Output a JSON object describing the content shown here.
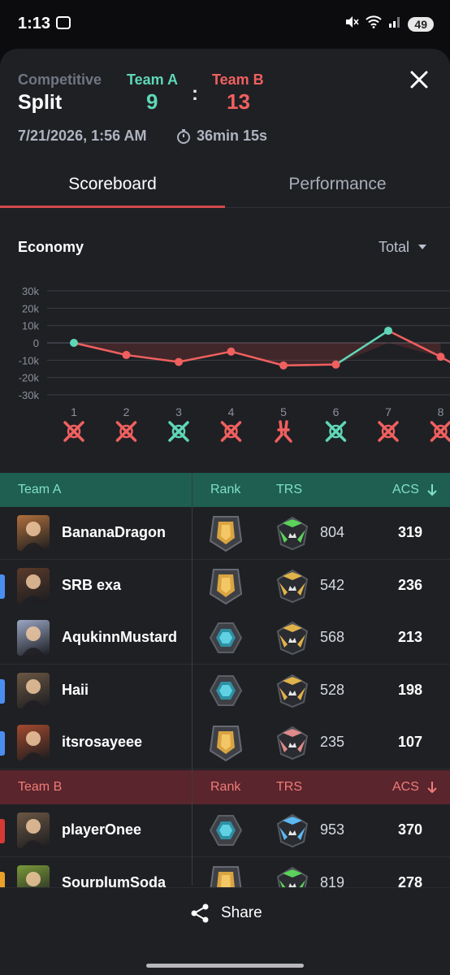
{
  "status_bar": {
    "time": "1:13",
    "battery": "49"
  },
  "header": {
    "mode": "Competitive",
    "map": "Split",
    "team_a": {
      "name": "Team A",
      "score": "9",
      "color": "#5fd7b7"
    },
    "team_b": {
      "name": "Team B",
      "score": "13",
      "color": "#f0605f"
    },
    "separator": ":",
    "date": "7/21/2026, 1:56 AM",
    "duration": "36min 15s"
  },
  "tabs": [
    {
      "label": "Scoreboard",
      "active": true
    },
    {
      "label": "Performance",
      "active": false
    }
  ],
  "economy": {
    "title": "Economy",
    "selector": "Total",
    "chart_data": {
      "type": "line",
      "y_ticks": [
        "30k",
        "20k",
        "10k",
        "0",
        "-10k",
        "-20k",
        "-30k"
      ],
      "ylim": [
        -30000,
        30000
      ],
      "x": [
        1,
        2,
        3,
        4,
        5,
        6,
        7,
        8
      ],
      "values": [
        0,
        -7000,
        -11000,
        -5000,
        -13000,
        -12500,
        7000,
        -8000
      ],
      "round_results": [
        {
          "round": "1",
          "winner": "B",
          "icon": "elimination-icon"
        },
        {
          "round": "2",
          "winner": "B",
          "icon": "elimination-icon"
        },
        {
          "round": "3",
          "winner": "A",
          "icon": "elimination-icon"
        },
        {
          "round": "4",
          "winner": "B",
          "icon": "elimination-icon"
        },
        {
          "round": "5",
          "winner": "B",
          "icon": "defuse-icon"
        },
        {
          "round": "6",
          "winner": "A",
          "icon": "elimination-icon"
        },
        {
          "round": "7",
          "winner": "B",
          "icon": "elimination-icon"
        },
        {
          "round": "8",
          "winner": "B",
          "icon": "elimination-icon"
        }
      ]
    }
  },
  "scoreboard": {
    "columns": {
      "rank": "Rank",
      "trs": "TRS",
      "acs": "ACS"
    },
    "teams": [
      {
        "name": "Team A",
        "header_color": "#1f5f51",
        "label_color": "#7fe0c6",
        "players": [
          {
            "name": "BananaDragon",
            "rank": "gold",
            "trs_tier": "green",
            "trs": "804",
            "acs": "319",
            "marker": null,
            "avatar": "#b0703c"
          },
          {
            "name": "SRB exa",
            "rank": "gold",
            "trs_tier": "gold",
            "trs": "542",
            "acs": "236",
            "marker": "#4a8ff0",
            "avatar": "#5b3b2a"
          },
          {
            "name": "AqukinnMustard",
            "rank": "platinum",
            "trs_tier": "gold",
            "trs": "568",
            "acs": "213",
            "marker": null,
            "avatar": "#9aa6c4"
          },
          {
            "name": "Haii",
            "rank": "platinum",
            "trs_tier": "gold",
            "trs": "528",
            "acs": "198",
            "marker": "#4a8ff0",
            "avatar": "#6b5744"
          },
          {
            "name": "itsrosayeee",
            "rank": "gold",
            "trs_tier": "red",
            "trs": "235",
            "acs": "107",
            "marker": "#4a8ff0",
            "avatar": "#a34a2e"
          }
        ]
      },
      {
        "name": "Team B",
        "header_color": "#5a252c",
        "label_color": "#f07b7b",
        "players": [
          {
            "name": "playerOnee",
            "rank": "platinum",
            "trs_tier": "blue",
            "trs": "953",
            "acs": "370",
            "marker": "#d63a35",
            "avatar": "#6b5744"
          },
          {
            "name": "SourplumSoda",
            "rank": "gold",
            "trs_tier": "green",
            "trs": "819",
            "acs": "278",
            "marker": "#e9a128",
            "avatar": "#7a9a3a"
          }
        ]
      }
    ]
  },
  "share": {
    "label": "Share"
  }
}
